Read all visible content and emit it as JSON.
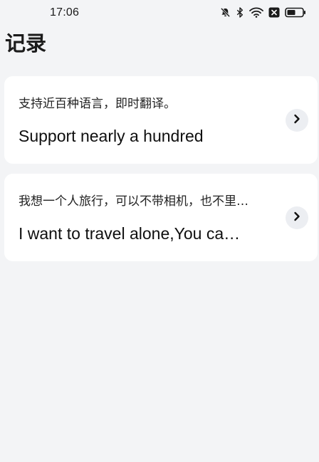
{
  "status_bar": {
    "time": "17:06",
    "icons": [
      "bell-off-icon",
      "bluetooth-icon",
      "wifi-icon",
      "close-box-icon",
      "battery-icon"
    ]
  },
  "page": {
    "title": "记录"
  },
  "records": [
    {
      "source": "支持近百种语言，即时翻译。",
      "translation": "Support nearly a hundred"
    },
    {
      "source": "我想一个人旅行，可以不带相机，也不里…",
      "translation": "I want to travel alone,You ca…"
    }
  ],
  "colors": {
    "background": "#f3f4f6",
    "card": "#ffffff",
    "chevron_bg": "#eceef2"
  }
}
